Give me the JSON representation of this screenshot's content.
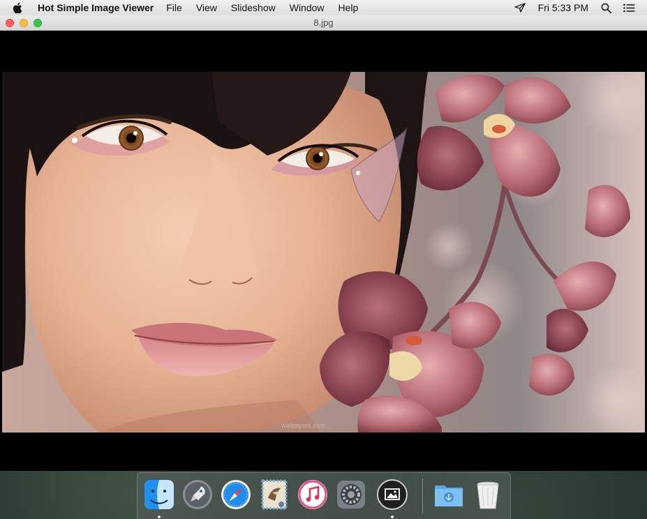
{
  "menubar": {
    "app_name": "Hot Simple Image Viewer",
    "menus": [
      "File",
      "View",
      "Slideshow",
      "Window",
      "Help"
    ],
    "clock": "Fri 5:33 PM",
    "icons": [
      "apple-icon",
      "airplay-icon",
      "spotlight-icon",
      "notification-center-icon"
    ]
  },
  "window": {
    "title": "8.jpg",
    "image_description_icon": "photo-content"
  },
  "image": {
    "watermark": "wallpapers.com"
  },
  "dock": {
    "items": [
      {
        "name": "finder",
        "running": true
      },
      {
        "name": "launchpad",
        "running": false
      },
      {
        "name": "safari",
        "running": false
      },
      {
        "name": "mail",
        "running": false
      },
      {
        "name": "itunes",
        "running": false
      },
      {
        "name": "system-preferences",
        "running": false
      },
      {
        "name": "hot-simple-image-viewer",
        "running": true
      },
      {
        "name": "downloads-folder",
        "running": false
      },
      {
        "name": "trash",
        "running": false
      }
    ]
  },
  "colors": {
    "close": "#fc605c",
    "minimize": "#fdbc40",
    "zoom": "#34c84a"
  }
}
